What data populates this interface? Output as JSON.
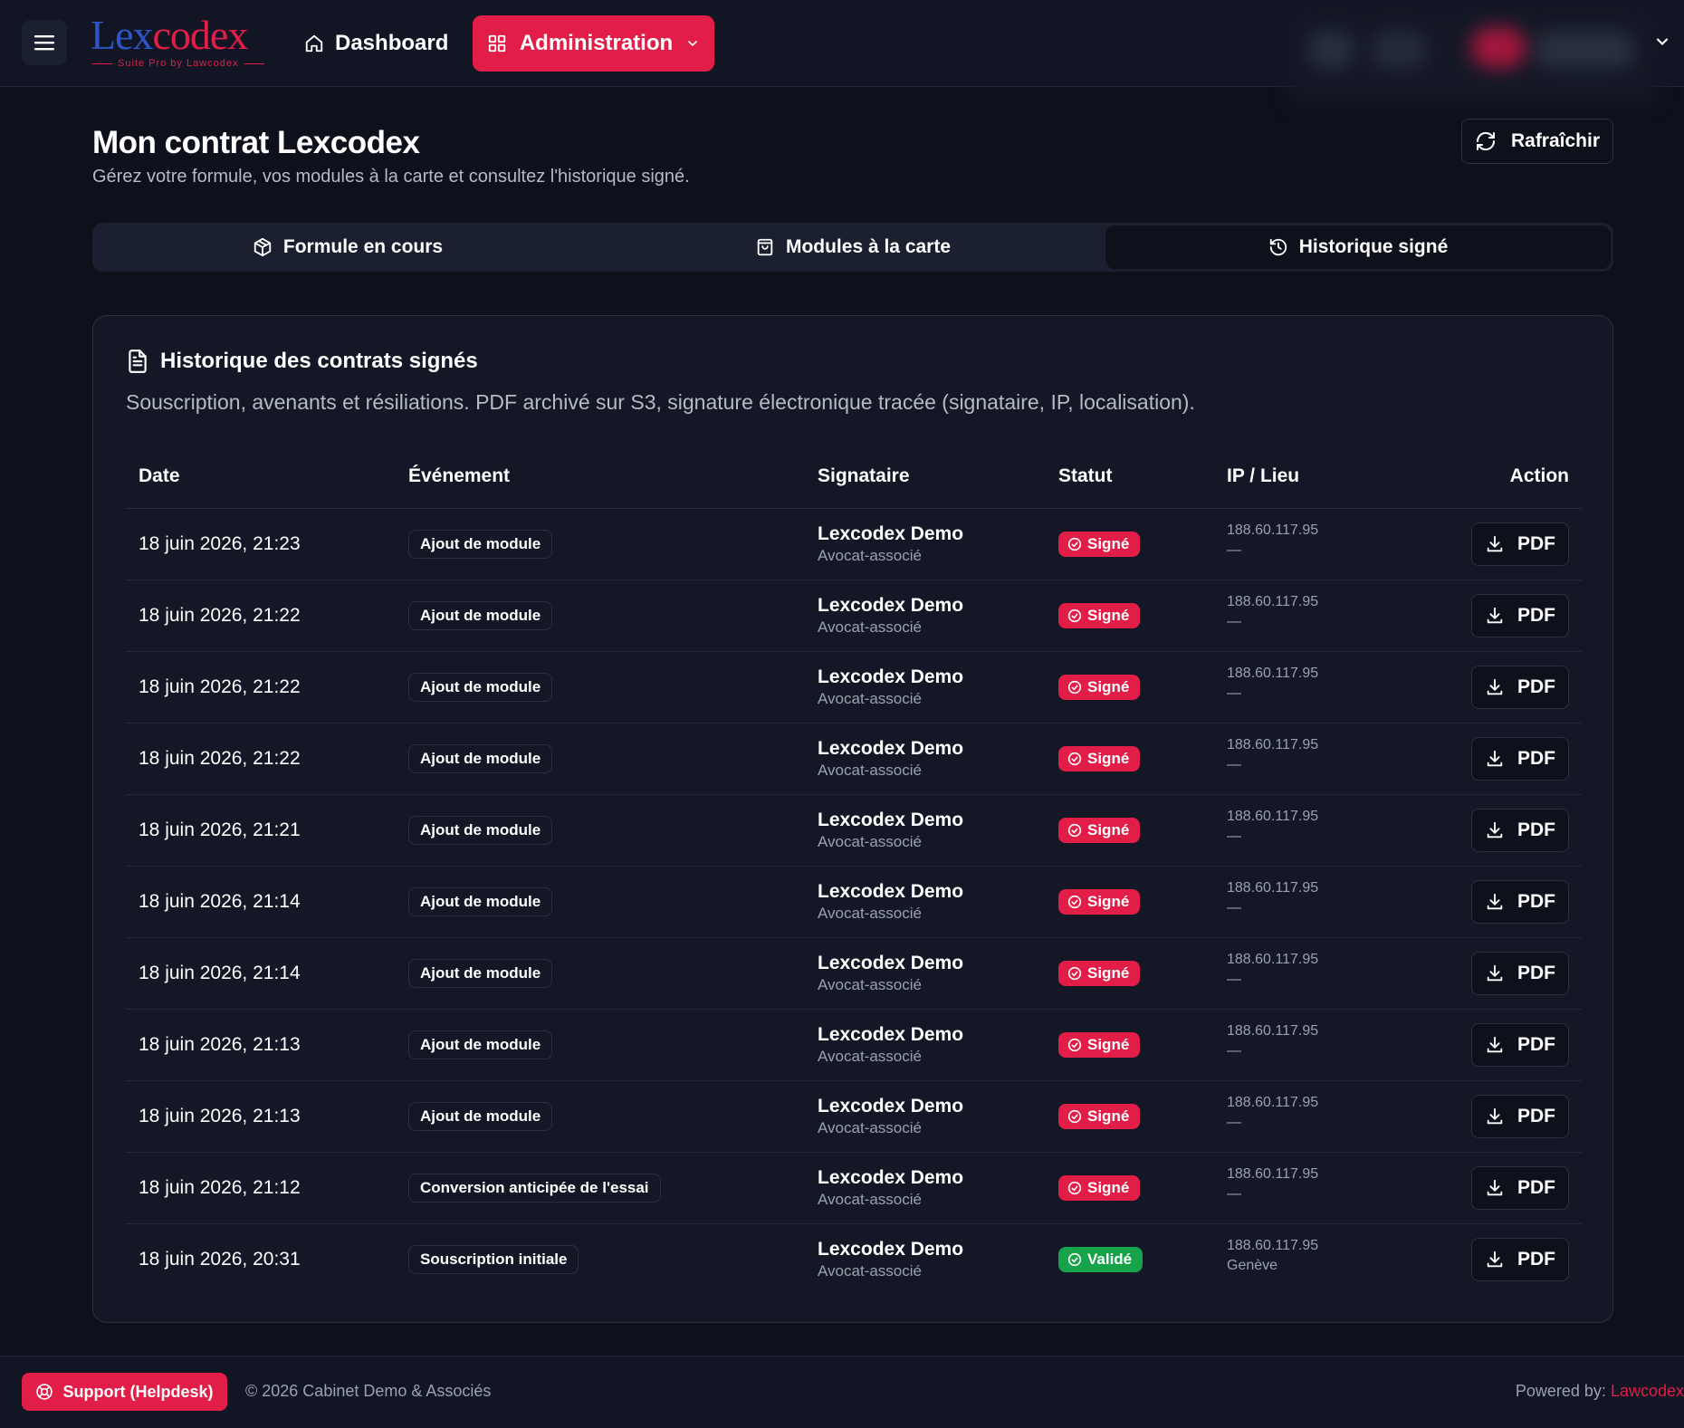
{
  "header": {
    "logo_text_a": "Lex",
    "logo_text_b": "codex",
    "logo_tagline": "Suite Pro by Lawcodex",
    "nav": {
      "dashboard_label": "Dashboard",
      "administration_label": "Administration"
    }
  },
  "page": {
    "title": "Mon contrat Lexcodex",
    "subtitle": "Gérez votre formule, vos modules à la carte et consultez l'historique signé.",
    "refresh_label": "Rafraîchir"
  },
  "tabs": [
    {
      "label": "Formule en cours",
      "icon": "package-icon",
      "active": false
    },
    {
      "label": "Modules à la carte",
      "icon": "shopping-bag-icon",
      "active": false
    },
    {
      "label": "Historique signé",
      "icon": "history-icon",
      "active": true
    }
  ],
  "history": {
    "title": "Historique des contrats signés",
    "description": "Souscription, avenants et résiliations. PDF archivé sur S3, signature électronique tracée (signataire, IP, localisation).",
    "columns": {
      "date": "Date",
      "event": "Événement",
      "signer": "Signataire",
      "status": "Statut",
      "ip": "IP / Lieu",
      "action": "Action"
    },
    "rows": [
      {
        "date": "18 juin 2026, 21:23",
        "event": "Ajout de module",
        "signer": "Lexcodex Demo",
        "role": "Avocat-associé",
        "status": "Signé",
        "ip": "188.60.117.95",
        "location": "—",
        "action": "PDF"
      },
      {
        "date": "18 juin 2026, 21:22",
        "event": "Ajout de module",
        "signer": "Lexcodex Demo",
        "role": "Avocat-associé",
        "status": "Signé",
        "ip": "188.60.117.95",
        "location": "—",
        "action": "PDF"
      },
      {
        "date": "18 juin 2026, 21:22",
        "event": "Ajout de module",
        "signer": "Lexcodex Demo",
        "role": "Avocat-associé",
        "status": "Signé",
        "ip": "188.60.117.95",
        "location": "—",
        "action": "PDF"
      },
      {
        "date": "18 juin 2026, 21:22",
        "event": "Ajout de module",
        "signer": "Lexcodex Demo",
        "role": "Avocat-associé",
        "status": "Signé",
        "ip": "188.60.117.95",
        "location": "—",
        "action": "PDF"
      },
      {
        "date": "18 juin 2026, 21:21",
        "event": "Ajout de module",
        "signer": "Lexcodex Demo",
        "role": "Avocat-associé",
        "status": "Signé",
        "ip": "188.60.117.95",
        "location": "—",
        "action": "PDF"
      },
      {
        "date": "18 juin 2026, 21:14",
        "event": "Ajout de module",
        "signer": "Lexcodex Demo",
        "role": "Avocat-associé",
        "status": "Signé",
        "ip": "188.60.117.95",
        "location": "—",
        "action": "PDF"
      },
      {
        "date": "18 juin 2026, 21:14",
        "event": "Ajout de module",
        "signer": "Lexcodex Demo",
        "role": "Avocat-associé",
        "status": "Signé",
        "ip": "188.60.117.95",
        "location": "—",
        "action": "PDF"
      },
      {
        "date": "18 juin 2026, 21:13",
        "event": "Ajout de module",
        "signer": "Lexcodex Demo",
        "role": "Avocat-associé",
        "status": "Signé",
        "ip": "188.60.117.95",
        "location": "—",
        "action": "PDF"
      },
      {
        "date": "18 juin 2026, 21:13",
        "event": "Ajout de module",
        "signer": "Lexcodex Demo",
        "role": "Avocat-associé",
        "status": "Signé",
        "ip": "188.60.117.95",
        "location": "—",
        "action": "PDF"
      },
      {
        "date": "18 juin 2026, 21:12",
        "event": "Conversion anticipée de l'essai",
        "signer": "Lexcodex Demo",
        "role": "Avocat-associé",
        "status": "Signé",
        "ip": "188.60.117.95",
        "location": "—",
        "action": "PDF"
      },
      {
        "date": "18 juin 2026, 20:31",
        "event": "Souscription initiale",
        "signer": "Lexcodex Demo",
        "role": "Avocat-associé",
        "status": "Validé",
        "ip": "188.60.117.95",
        "location": "Genève",
        "action": "PDF"
      }
    ]
  },
  "footer": {
    "support_label": "Support (Helpdesk)",
    "copyright": "© 2026 Cabinet Demo & Associés",
    "powered_label": "Powered by: ",
    "powered_brand": "Lawcodex"
  },
  "colors": {
    "accent": "#e11d48",
    "signed_badge": "#e11d48",
    "validated_badge": "#16a34a",
    "background": "#0e111c",
    "surface": "#141826"
  }
}
